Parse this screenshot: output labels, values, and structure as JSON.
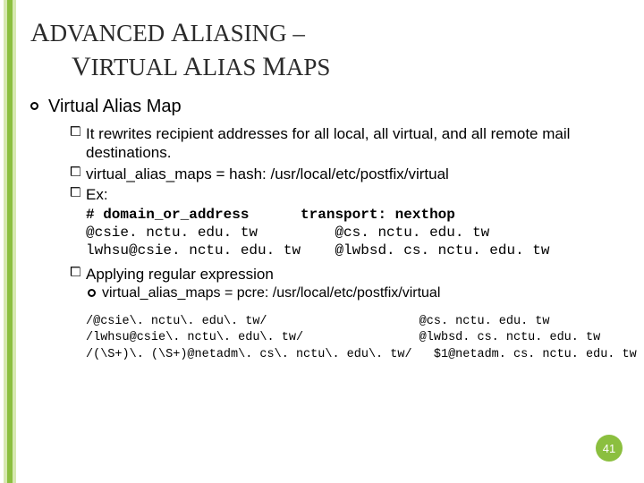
{
  "title": {
    "line1": {
      "w1cap": "A",
      "w1rest": "DVANCED",
      "w2cap": "A",
      "w2rest": "LIASING",
      "dash": "–"
    },
    "line2": {
      "w1cap": "V",
      "w1rest": "IRTUAL",
      "w2cap": "A",
      "w2rest": "LIAS",
      "w3cap": "M",
      "w3rest": "APS"
    }
  },
  "h1": "Virtual Alias Map",
  "bullets": {
    "b1": "It rewrites recipient addresses for all local, all virtual, and all remote mail destinations.",
    "b2": "virtual_alias_maps = hash: /usr/local/etc/postfix/virtual",
    "b3": "Ex:",
    "b4": "Applying regular expression"
  },
  "ex_header": "# domain_or_address      transport: nexthop",
  "ex_rows": [
    "@csie. nctu. edu. tw         @cs. nctu. edu. tw",
    "lwhsu@csie. nctu. edu. tw    @lwbsd. cs. nctu. edu. tw"
  ],
  "lvl3": "virtual_alias_maps = pcre: /usr/local/etc/postfix/virtual",
  "regex_rows": [
    "/@csie\\. nctu\\. edu\\. tw/                     @cs. nctu. edu. tw",
    "/lwhsu@csie\\. nctu\\. edu\\. tw/                @lwbsd. cs. nctu. edu. tw",
    "/(\\S+)\\. (\\S+)@netadm\\. cs\\. nctu\\. edu\\. tw/   $1@netadm. cs. nctu. edu. tw"
  ],
  "page_number": "41"
}
